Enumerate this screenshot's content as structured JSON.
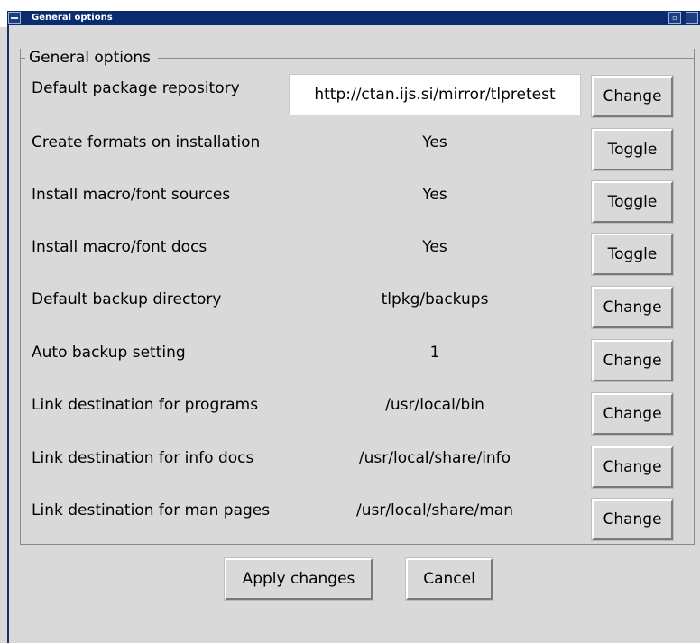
{
  "window": {
    "title": "General options",
    "icons": [
      "window-menu-icon",
      "minimize-icon",
      "close-icon"
    ]
  },
  "group": {
    "title": "General options",
    "rows": [
      {
        "label": "Default package repository",
        "value": "http://ctan.ijs.si/mirror/tlpretest",
        "button": "Change"
      },
      {
        "label": "Create formats on installation",
        "value": "Yes",
        "button": "Toggle"
      },
      {
        "label": "Install macro/font sources",
        "value": "Yes",
        "button": "Toggle"
      },
      {
        "label": "Install macro/font docs",
        "value": "Yes",
        "button": "Toggle"
      },
      {
        "label": "Default backup directory",
        "value": "tlpkg/backups",
        "button": "Change"
      },
      {
        "label": "Auto backup setting",
        "value": "1",
        "button": "Change"
      },
      {
        "label": "Link destination for programs",
        "value": "/usr/local/bin",
        "button": "Change"
      },
      {
        "label": "Link destination for info docs",
        "value": "/usr/local/share/info",
        "button": "Change"
      },
      {
        "label": "Link destination for man pages",
        "value": "/usr/local/share/man",
        "button": "Change"
      }
    ]
  },
  "actions": {
    "apply_label": "Apply changes",
    "cancel_label": "Cancel"
  },
  "colors": {
    "titlebar": "#0a2c6e",
    "background": "#d9d9d9",
    "field_background": "#ffffff"
  }
}
